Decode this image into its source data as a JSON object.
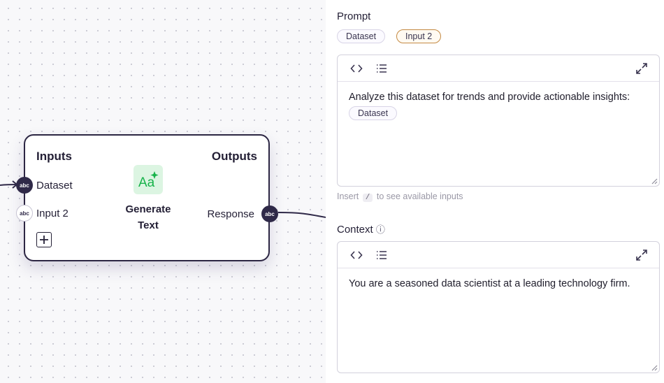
{
  "node": {
    "inputs_heading": "Inputs",
    "outputs_heading": "Outputs",
    "title_line1": "Generate",
    "title_line2": "Text",
    "inputs": [
      {
        "label": "Dataset",
        "type": "abc",
        "connected": true
      },
      {
        "label": "Input 2",
        "type": "abc",
        "connected": false
      }
    ],
    "outputs": [
      {
        "label": "Response",
        "type": "abc",
        "connected": true
      }
    ],
    "icon": "text-sparkle-icon",
    "add_icon": "plus-icon",
    "colors": {
      "border": "#2c2643",
      "port": "#2f2948",
      "icon_bg": "#dcf5e2",
      "icon_fg": "#17b34a"
    }
  },
  "prompt": {
    "label": "Prompt",
    "chips": [
      {
        "label": "Dataset",
        "active": false
      },
      {
        "label": "Input 2",
        "active": true
      }
    ],
    "text": "Analyze this dataset for trends and provide actionable insights:",
    "inline_chip": "Dataset",
    "hint_before": "Insert",
    "hint_key": "/",
    "hint_after": "to see available inputs"
  },
  "context": {
    "label": "Context",
    "info_icon": "ⓘ",
    "text": "You are a seasoned data scientist at a leading technology firm."
  },
  "toolbar_icons": [
    "code-icon",
    "list-icon",
    "expand-icon"
  ]
}
